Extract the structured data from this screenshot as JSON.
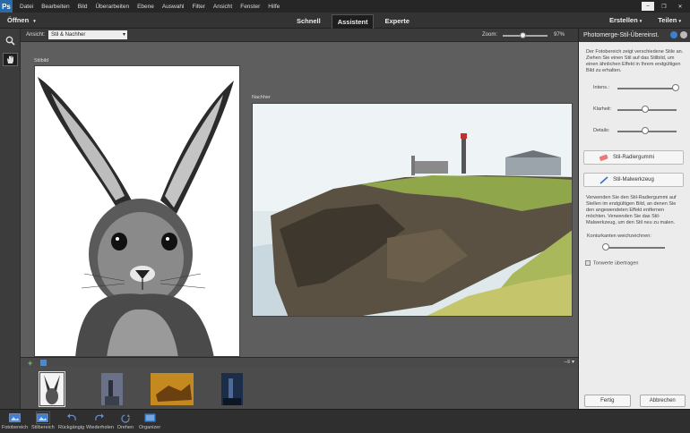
{
  "menu": {
    "logo": "Ps",
    "items": [
      "Datei",
      "Bearbeiten",
      "Bild",
      "Überarbeiten",
      "Ebene",
      "Auswahl",
      "Filter",
      "Ansicht",
      "Fenster",
      "Hilfe"
    ]
  },
  "topbar": {
    "open_label": "Öffnen",
    "tabs": [
      "Schnell",
      "Assistent",
      "Experte"
    ],
    "active_tab": "Assistent",
    "create_label": "Erstellen",
    "share_label": "Teilen"
  },
  "options": {
    "view_label": "Ansicht:",
    "view_value": "Stil & Nachher",
    "zoom_label": "Zoom:",
    "zoom_value": "97%"
  },
  "canvas": {
    "style_caption": "Stilbild",
    "after_caption": "Nachher"
  },
  "panel": {
    "title": "Photomerge-Stil-Übereinst.",
    "description": "Der Fotobereich zeigt verschiedene Stile an. Ziehen Sie einen Stil auf das Stilbild, um einen ähnlichen Effekt in Ihrem endgültigen Bild zu erhalten.",
    "sliders": {
      "intensity_label": "Intens.:",
      "clarity_label": "Klarheit:",
      "details_label": "Details:"
    },
    "eraser_label": "Stil-Radiergummi",
    "brush_label": "Stil-Malwerkzeug",
    "tool_help": "Verwenden Sie den Stil-Radiergummi auf Stellen im endgültigen Bild, an denen Sie den angewendeten Effekt entfernen möchten. Verwenden Sie das Stil-Malwerkzeug, um den Stil neu zu malen.",
    "feather_label": "Konturkanten weichzeichnen:",
    "transfer_label": "Tonwerte übertragen",
    "done_label": "Fertig",
    "cancel_label": "Abbrechen"
  },
  "taskbar": {
    "items": [
      "Fotobereich",
      "Stilbereich",
      "Rückgängig",
      "Wiederholen",
      "Drehen",
      "Organizer"
    ]
  },
  "colors": {
    "accent": "#2a6aa8",
    "panel_bg": "#ececec",
    "canvas_bg": "#5e5e5e"
  }
}
